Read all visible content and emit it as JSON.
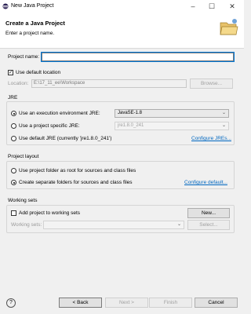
{
  "window": {
    "title": "New Java Project",
    "controls": [
      "–",
      "☐",
      "✕"
    ]
  },
  "header": {
    "title": "Create a Java Project",
    "subtitle": "Enter a project name."
  },
  "project_name": {
    "label": "Project name:",
    "value": ""
  },
  "default_location": {
    "checkbox_label": "Use default location",
    "checked": true
  },
  "location": {
    "label": "Location:",
    "value": "E:\\17_11_ee\\Workspace",
    "browse_label": "Browse..."
  },
  "jre": {
    "title": "JRE",
    "option1": "Use an execution environment JRE:",
    "option1_value": "JavaSE-1.8",
    "option2": "Use a project specific JRE:",
    "option2_value": "jre1.8.0_241",
    "option3": "Use default JRE (currently 'jre1.8.0_241')",
    "configure_link": "Configure JREs..."
  },
  "layout": {
    "title": "Project layout",
    "option1": "Use project folder as root for sources and class files",
    "option2": "Create separate folders for sources and class files",
    "configure_link": "Configure default..."
  },
  "working_sets": {
    "title": "Working sets",
    "add_label": "Add project to working sets",
    "new_label": "New...",
    "sets_label": "Working sets:",
    "select_label": "Select..."
  },
  "footer": {
    "help": "?",
    "back": "< Back",
    "next": "Next >",
    "finish": "Finish",
    "cancel": "Cancel"
  }
}
